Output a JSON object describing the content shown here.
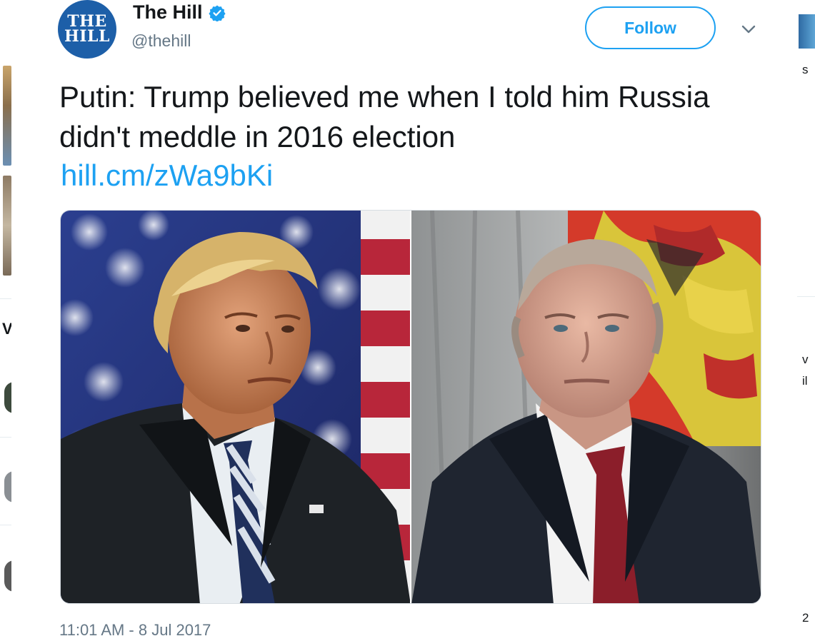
{
  "tweet": {
    "avatar_text_line1": "THE",
    "avatar_text_line2": "HILL",
    "display_name": "The Hill",
    "handle": "@thehill",
    "follow_label": "Follow",
    "text": "Putin: Trump believed me when I told him Russia didn't meddle in 2016 election",
    "link": "hill.cm/zWa9bKi",
    "timestamp": "11:01 AM - 8 Jul 2017",
    "media": {
      "left_image": "photo of Donald Trump in front of American flag",
      "right_image": "photo of Vladimir Putin in front of Russian coat of arms"
    }
  },
  "background": {
    "right_edge_text": [
      "s",
      "v",
      "il",
      "2"
    ],
    "left_edge_letter": "V"
  },
  "colors": {
    "accent": "#1da1f2",
    "text": "#14171a",
    "secondary_text": "#657786",
    "avatar_bg": "#1d5fa8"
  },
  "icons": {
    "verified": "verified-badge-icon",
    "caret": "chevron-down-icon"
  }
}
